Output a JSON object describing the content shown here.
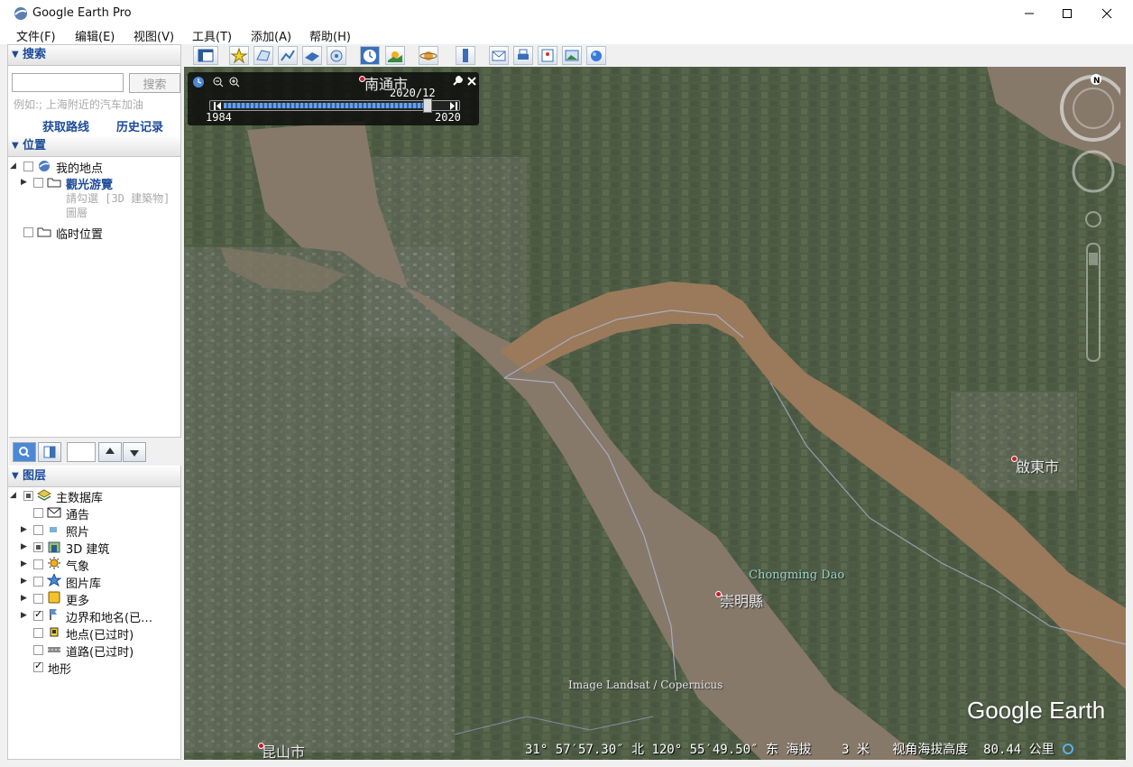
{
  "app": {
    "title": "Google Earth Pro"
  },
  "menu": [
    "文件(F)",
    "编辑(E)",
    "视图(V)",
    "工具(T)",
    "添加(A)",
    "帮助(H)"
  ],
  "search": {
    "header": "搜索",
    "button": "搜索",
    "example": "例如:; 上海附近的汽车加油",
    "get_route": "获取路线",
    "history": "历史记录"
  },
  "places": {
    "header": "位置",
    "items": [
      {
        "label": "我的地点",
        "icon": "globe-icon"
      },
      {
        "label": "觀光游覽",
        "icon": "folder-icon"
      },
      {
        "label": "請勾選 [3D 建築物] 圖層"
      },
      {
        "label": "临时位置",
        "icon": "folder-icon"
      }
    ]
  },
  "layers": {
    "header": "图层",
    "items": [
      {
        "label": "主数据库",
        "icon": "layers-icon",
        "checked": "partial"
      },
      {
        "label": "通告",
        "icon": "envelope-icon",
        "checked": "off"
      },
      {
        "label": "照片",
        "icon": "photo-icon",
        "checked": "off"
      },
      {
        "label": "3D 建筑",
        "icon": "building-icon",
        "checked": "partial"
      },
      {
        "label": "气象",
        "icon": "sun-icon",
        "checked": "off"
      },
      {
        "label": "图片库",
        "icon": "star-icon",
        "checked": "off"
      },
      {
        "label": "更多",
        "icon": "more-icon",
        "checked": "off"
      },
      {
        "label": "边界和地名(已…",
        "icon": "flag-icon",
        "checked": "on"
      },
      {
        "label": "地点(已过时)",
        "icon": "place-icon",
        "checked": "off"
      },
      {
        "label": "道路(已过时)",
        "icon": "road-icon",
        "checked": "off"
      },
      {
        "label": "地形",
        "checked": "on"
      }
    ]
  },
  "time_slider": {
    "current": "2020/12",
    "start": "1984",
    "end": "2020",
    "position": 0.94
  },
  "map_labels": {
    "nantong": "南通市",
    "qidong": "啟東市",
    "chongming_dao": "Chongming Dao",
    "chongming_county": "崇明縣",
    "kunshan": "昆山市",
    "credit": "Image Landsat / Copernicus",
    "logo": "Google Earth"
  },
  "status_bar": {
    "lat": "31° 57′57.30″ 北",
    "lon": "120° 55′49.50″ 东",
    "elev_label": "海拔",
    "elev_value": "3 米",
    "eye_label": "视角海拔高度",
    "eye_value": "80.44 公里"
  },
  "colors": {
    "accent": "#1d4b9a",
    "water": "#86796a",
    "river_brown": "#9a7a5a",
    "land": "#4f5c45"
  }
}
